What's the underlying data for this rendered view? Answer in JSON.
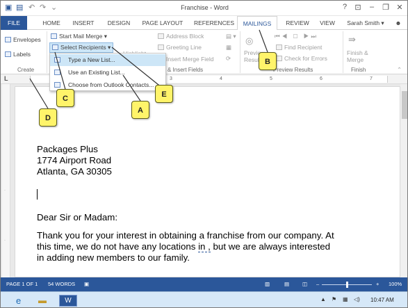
{
  "window": {
    "title": "Franchise - Word",
    "help_label": "?",
    "user_name": "Sarah Smith"
  },
  "tabs": [
    "FILE",
    "HOME",
    "INSERT",
    "DESIGN",
    "PAGE LAYOUT",
    "REFERENCES",
    "MAILINGS",
    "REVIEW",
    "VIEW"
  ],
  "active_tab": "MAILINGS",
  "ribbon": {
    "create": {
      "envelopes": "Envelopes",
      "labels": "Labels",
      "group": "Create"
    },
    "start_mail_merge": "Start Mail Merge",
    "select_recipients": "Select Recipients",
    "highlight": "Highlight",
    "write_insert": {
      "address_block": "Address Block",
      "greeting_line": "Greeting Line",
      "insert_merge_field": "Insert Merge Field",
      "group": "& Insert Fields"
    },
    "preview": {
      "preview_results": "Preview Results",
      "find_recipient": "Find Recipient",
      "check_errors": "Check for Errors",
      "group": "Preview Results"
    },
    "finish": {
      "label": "Finish & Merge",
      "group": "Finish"
    }
  },
  "dropdown": {
    "items": [
      "Type a New List...",
      "Use an Existing List...",
      "Choose from Outlook Contacts..."
    ],
    "highlighted_index": 0
  },
  "ruler": {
    "numbers": [
      "1",
      "2",
      "3",
      "4",
      "5",
      "6",
      "7"
    ]
  },
  "document": {
    "address_lines": [
      "Packages Plus",
      "1774 Airport Road",
      "Atlanta, GA  30305"
    ],
    "salutation": "Dear Sir or Madam:",
    "body_line1": "Thank you for your interest in obtaining a franchise from our company. At",
    "body_line2_pre": "this time, we do not have any locations ",
    "body_line2_squiggle": "in ,",
    "body_line2_post": " but we are always interested",
    "body_line3": "in adding new members to our family."
  },
  "status": {
    "page": "PAGE 1 OF 1",
    "words": "54 WORDS",
    "zoom": "100%",
    "zoom_fraction": 0.5
  },
  "taskbar": {
    "time": "10:47 AM"
  },
  "callouts": [
    "A",
    "B",
    "C",
    "D",
    "E"
  ],
  "colors": {
    "word_blue": "#2b579a",
    "callout_yellow": "#fff46a",
    "dropdown_highlight": "#cde6f7"
  }
}
